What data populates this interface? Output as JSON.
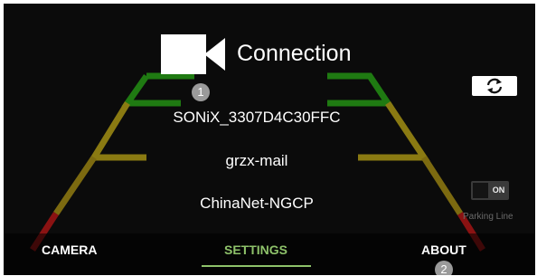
{
  "header": {
    "title": "Connection",
    "icon": "video-camera-icon"
  },
  "badges": {
    "first": "1",
    "second": "2"
  },
  "networks": [
    {
      "ssid": "SONiX_3307D4C30FFC"
    },
    {
      "ssid": "grzx-mail"
    },
    {
      "ssid": "ChinaNet-NGCP"
    }
  ],
  "controls": {
    "switch_camera_icon": "rotate-camera-icon",
    "parking_toggle_state": "ON",
    "parking_label": "Parking Line"
  },
  "nav": {
    "tabs": [
      {
        "label": "CAMERA",
        "active": false
      },
      {
        "label": "SETTINGS",
        "active": true
      },
      {
        "label": "ABOUT",
        "active": false
      }
    ]
  },
  "colors": {
    "background": "#0b0b0b",
    "active_tab": "#8ec26a",
    "guide_green": "#1f7a12",
    "guide_yellow": "#8a7a12",
    "guide_red": "#8a1212"
  }
}
